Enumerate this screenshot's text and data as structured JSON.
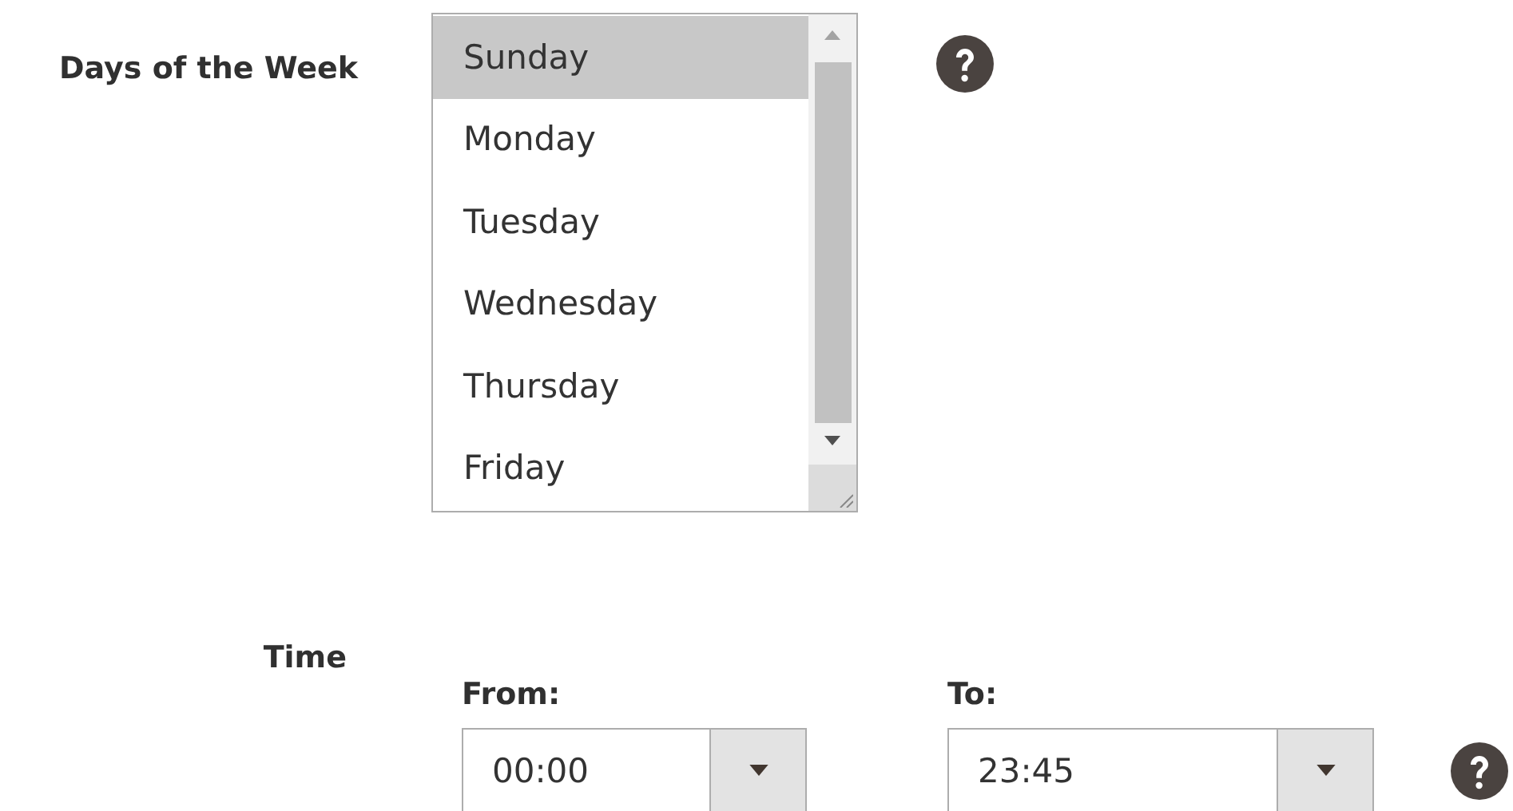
{
  "days_field": {
    "label": "Days of the Week",
    "options": [
      {
        "label": "Sunday",
        "selected": true
      },
      {
        "label": "Monday",
        "selected": false
      },
      {
        "label": "Tuesday",
        "selected": false
      },
      {
        "label": "Wednesday",
        "selected": false
      },
      {
        "label": "Thursday",
        "selected": false
      },
      {
        "label": "Friday",
        "selected": false
      }
    ]
  },
  "time_field": {
    "label": "Time",
    "ranges": [
      {
        "label": "From:",
        "value": "00:00"
      },
      {
        "label": "To:",
        "value": "23:45"
      }
    ]
  }
}
